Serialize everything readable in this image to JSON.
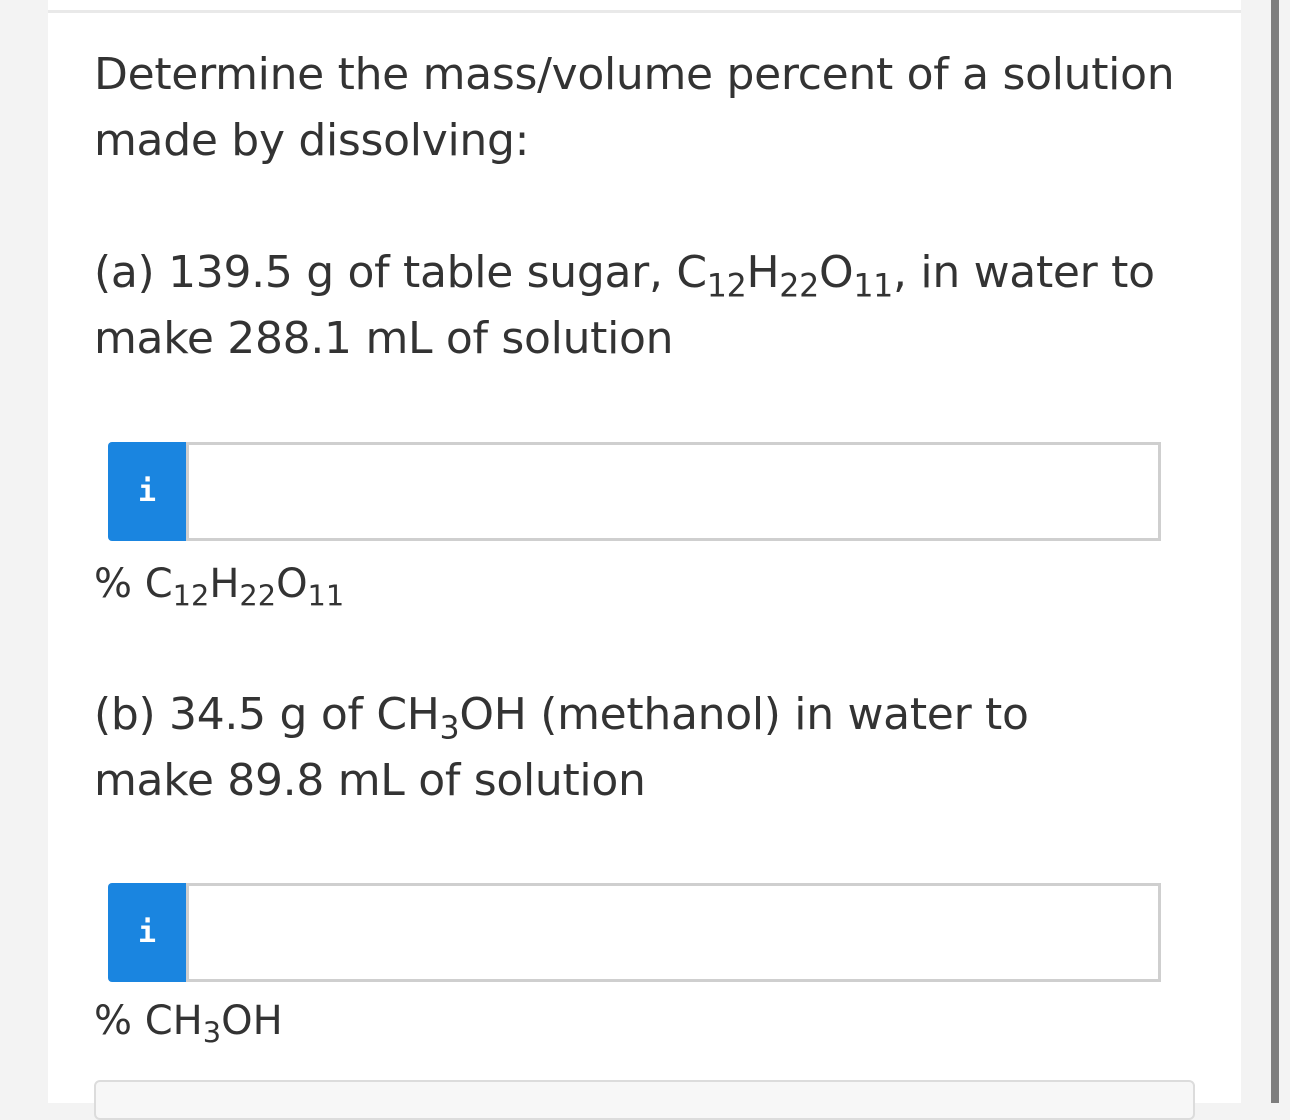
{
  "question": {
    "intro_line1": "Determine the mass/volume percent of a solution",
    "intro_line2": "made by dissolving:"
  },
  "part_a": {
    "prefix": "(a) 139.5 g of table sugar, ",
    "formula_c": "C",
    "formula_c_sub": "12",
    "formula_h": "H",
    "formula_h_sub": "22",
    "formula_o": "O",
    "formula_o_sub": "11",
    "suffix": ", in water to",
    "line2": "make 288.1 mL of solution",
    "info_icon": "i",
    "input_value": "",
    "unit_percent": "%",
    "unit_c": "C",
    "unit_c_sub": "12",
    "unit_h": "H",
    "unit_h_sub": "22",
    "unit_o": "O",
    "unit_o_sub": "11"
  },
  "part_b": {
    "prefix": "(b) 34.5 g of ",
    "formula_main": "CH",
    "formula_sub": "3",
    "formula_end": "OH",
    "suffix": " (methanol) in water to",
    "line2": "make 89.8 mL of solution",
    "info_icon": "i",
    "input_value": "",
    "unit_percent": "%",
    "unit_main": "CH",
    "unit_sub": "3",
    "unit_end": "OH"
  },
  "colors": {
    "info_button": "#1a85e0",
    "text": "#333333",
    "input_border": "#cfcfcf"
  },
  "icons": {
    "info": "info-icon"
  }
}
